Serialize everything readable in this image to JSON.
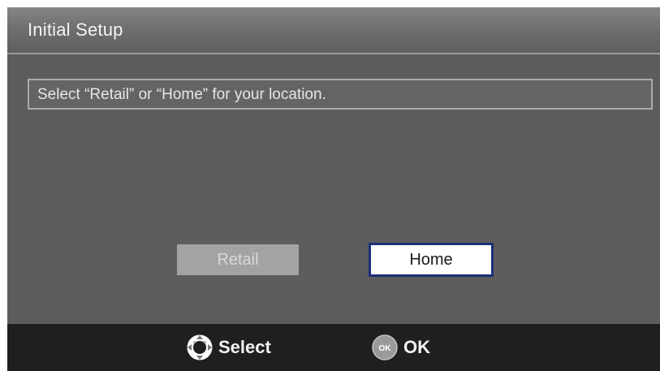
{
  "window": {
    "title": "Initial Setup"
  },
  "prompt": {
    "text": "Select “Retail” or “Home” for your location."
  },
  "options": [
    {
      "label": "Retail",
      "selected": false
    },
    {
      "label": "Home",
      "selected": true
    }
  ],
  "footer": {
    "hints": [
      {
        "icon": "directional-pad-icon",
        "label": "Select"
      },
      {
        "icon": "ok-button-icon",
        "label": "OK",
        "icon_text": "OK"
      }
    ]
  },
  "colors": {
    "background": "#5c5c5c",
    "title_bar": "#757575",
    "footer": "#1f1f1f",
    "selected_border": "#1d2f7a",
    "unselected_option": "#a3a3a3"
  }
}
